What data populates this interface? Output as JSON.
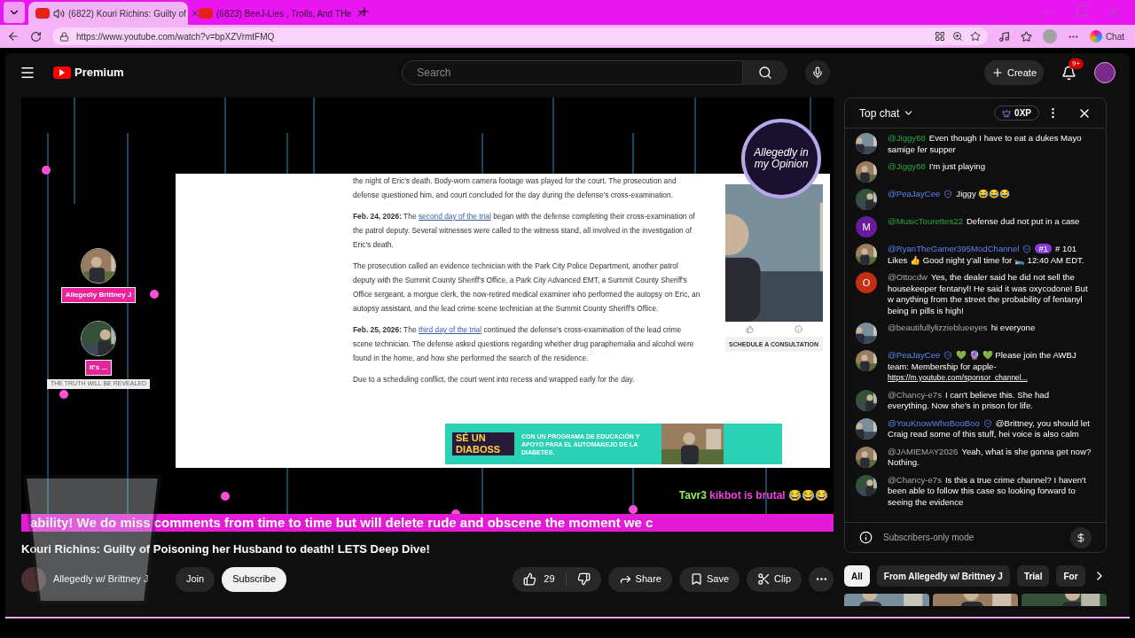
{
  "browser": {
    "tabs": [
      {
        "title": "(6822) Kouri Richins: Guilty of",
        "selected": true,
        "audio": true
      },
      {
        "title": "(6823) BeeJ-Lies , Trolls, And THe",
        "selected": false,
        "audio": false
      }
    ],
    "url": "https://www.youtube.com/watch?v=bpXZVrmtFMQ",
    "chat_label": "Chat"
  },
  "header": {
    "logo": "Premium",
    "search_placeholder": "Search",
    "create": "Create",
    "notifications": "9+"
  },
  "stream": {
    "logo_text": "Allegedly in my Opinion",
    "hosts": [
      {
        "label": "Allegedly Brittney J"
      },
      {
        "label": "It's ...",
        "sub": "THE TRUTH WILL BE REVEALED"
      }
    ],
    "article": {
      "paragraphs": [
        [
          {
            "kind": "text",
            "text": "the night of Eric's death. Body-worn camera footage was played for the court. The prosecution and defense questioned him, and court concluded for the day during the defense's cross-examination."
          }
        ],
        [
          {
            "kind": "bold",
            "text": "Feb. 24, 2026:"
          },
          {
            "kind": "text",
            "text": " The "
          },
          {
            "kind": "link",
            "text": "second day of the trial"
          },
          {
            "kind": "text",
            "text": " began with the defense completing their cross-examination of the patrol deputy. Several witnesses were called to the witness stand, all involved in the investigation of Eric's death."
          }
        ],
        [
          {
            "kind": "text",
            "text": "The prosecution called an evidence technician with the Park City Police Department, another patrol deputy with the Summit County Sheriff's Office, a Park City Advanced EMT, a Summit County Sheriff's Office sergeant, a morgue clerk, the now-retired medical examiner who performed the autopsy on Eric, an autopsy assistant, and the lead crime scene technician at the Summit County Sheriff's Office."
          }
        ],
        [
          {
            "kind": "bold",
            "text": "Feb. 25, 2026:"
          },
          {
            "kind": "text",
            "text": " The "
          },
          {
            "kind": "link",
            "text": "third day of the trial"
          },
          {
            "kind": "text",
            "text": " continued the defense's cross-examination of the lead crime scene technician. The defense asked questions regarding whether drug paraphernalia and alcohol were found in the home, and how she performed the search of the residence."
          }
        ],
        [
          {
            "kind": "text",
            "text": "Due to a scheduling conflict, the court went into recess and wrapped early for the day."
          }
        ]
      ],
      "side_button": "SCHEDULE A CONSULTATION",
      "ad_title": "SÉ UN DIABOSS",
      "ad_text": "CON UN PROGRAMA DE EDUCACIÓN Y APOYO PARA EL AUTOMANEJO DE LA DIABETES."
    },
    "overlay_chat": {
      "author": "Tavr3",
      "text": "kikbot is brutal 😂😂😂"
    },
    "ticker": "ability! We do miss comments from time to time but will delete rude and obscene the moment we c"
  },
  "video": {
    "title": "Kouri Richins: Guilty of Poisoning her Husband to death! LETS Deep Dive!",
    "channel": "Allegedly w/ Brittney J",
    "join": "Join",
    "subscribe": "Subscribe",
    "likes": "29",
    "share": "Share",
    "save": "Save",
    "clip": "Clip"
  },
  "chat": {
    "mode": "Top chat",
    "xp": "0XP",
    "messages": [
      {
        "author": "@Jiggy68",
        "kind": "member",
        "verified": false,
        "text": "Even though I have to eat a dukes Mayo samige fer supper"
      },
      {
        "author": "@Jiggy68",
        "kind": "member",
        "verified": false,
        "text": "I'm just playing"
      },
      {
        "author": "@PeaJayCee",
        "kind": "moderator",
        "verified": true,
        "text": "Jiggy 😂😂😂"
      },
      {
        "author": "@MusicTourettes22",
        "kind": "member",
        "verified": false,
        "avatar": {
          "kind": "letter",
          "letter": "M",
          "color": "#6a1b9a"
        },
        "text": "Defense dud not put in a case"
      },
      {
        "author": "@RyanTheGamer395ModChannel",
        "kind": "moderator",
        "verified": true,
        "rank": "#1",
        "text": "# 101 Likes 👍 Good night y'all time for 🛌 12:40 AM EDT."
      },
      {
        "author": "@Ottocdw",
        "kind": "viewer",
        "verified": false,
        "avatar": {
          "kind": "letter",
          "letter": "O",
          "color": "#c62e14"
        },
        "text": "Yes, the dealer said he did not sell the housekeeper fentanyl! He said it was oxycodone! But w anything from the street the probability of fentanyl being in pills is high!"
      },
      {
        "author": "@beautifullylizzieblueeyes",
        "kind": "viewer",
        "verified": false,
        "text": "hi everyone"
      },
      {
        "author": "@PeaJayCee",
        "kind": "moderator",
        "verified": true,
        "text": "💚 🔮 💚 Please join the AWBJ team: Membership for apple-",
        "link": "https://m.youtube.com/sponsor_channel..."
      },
      {
        "author": "@Chancy-e7s",
        "kind": "viewer",
        "verified": false,
        "text": "I can't believe this. She had everything. Now she's in prison for life."
      },
      {
        "author": "@YouKnowWhoBooBoo",
        "kind": "moderator",
        "verified": true,
        "text": "@Brittney, you should let Craig read some of this stuff, hei voice is also calm"
      },
      {
        "author": "@JAMIEMAY2026",
        "kind": "viewer",
        "verified": false,
        "text": "Yeah, what is she gonna get now? Nothing."
      },
      {
        "author": "@Chancy-e7s",
        "kind": "viewer",
        "verified": false,
        "text": "Is this a true crime channel? I haven't been able to follow this case so looking forward to seeing the evidence"
      }
    ],
    "footer": "Subscribers-only mode"
  },
  "chips": [
    {
      "label": "All",
      "selected": true
    },
    {
      "label": "From Allegedly w/ Brittney J",
      "selected": false
    },
    {
      "label": "Trial",
      "selected": false
    },
    {
      "label": "For",
      "selected": false
    }
  ]
}
